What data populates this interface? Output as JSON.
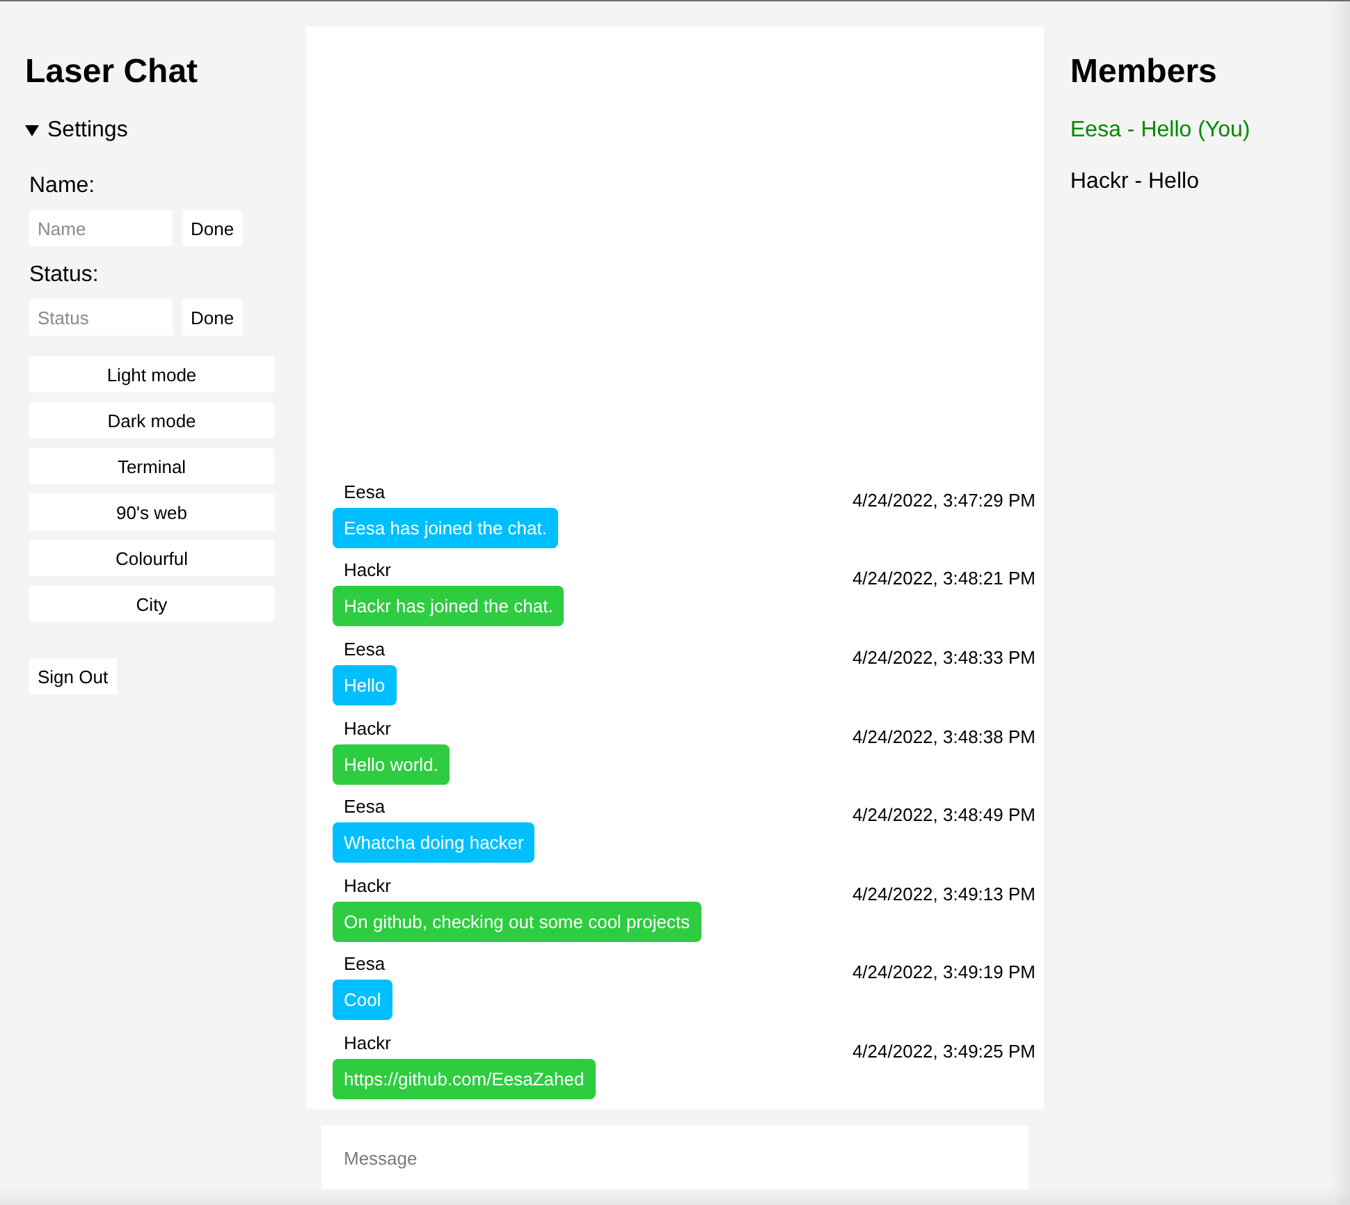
{
  "sidebar": {
    "title": "Laser Chat",
    "settings": {
      "label": "Settings",
      "expanded": true,
      "fields": [
        {
          "label": "Name:",
          "placeholder": "Name",
          "button": "Done"
        },
        {
          "label": "Status:",
          "placeholder": "Status",
          "button": "Done"
        }
      ],
      "themes": [
        "Light mode",
        "Dark mode",
        "Terminal",
        "90's web",
        "Colourful",
        "City"
      ]
    },
    "sign_out": "Sign Out"
  },
  "chat": {
    "messages": [
      {
        "author": "Eesa",
        "text": "Eesa has joined the chat.",
        "time": "4/24/2022, 3:47:29 PM",
        "color": "#00bfff"
      },
      {
        "author": "Hackr",
        "text": "Hackr has joined the chat.",
        "time": "4/24/2022, 3:48:21 PM",
        "color": "#2ecc40"
      },
      {
        "author": "Eesa",
        "text": "Hello",
        "time": "4/24/2022, 3:48:33 PM",
        "color": "#00bfff"
      },
      {
        "author": "Hackr",
        "text": "Hello world.",
        "time": "4/24/2022, 3:48:38 PM",
        "color": "#2ecc40"
      },
      {
        "author": "Eesa",
        "text": "Whatcha doing hacker",
        "time": "4/24/2022, 3:48:49 PM",
        "color": "#00bfff"
      },
      {
        "author": "Hackr",
        "text": "On github, checking out some cool projects",
        "time": "4/24/2022, 3:49:13 PM",
        "color": "#2ecc40"
      },
      {
        "author": "Eesa",
        "text": "Cool",
        "time": "4/24/2022, 3:49:19 PM",
        "color": "#00bfff"
      },
      {
        "author": "Hackr",
        "text": "https://github.com/EesaZahed",
        "time": "4/24/2022, 3:49:25 PM",
        "color": "#2ecc40"
      }
    ]
  },
  "composer": {
    "placeholder": "Message"
  },
  "members": {
    "title": "Members",
    "items": [
      {
        "label": "Eesa - Hello (You)",
        "you": true
      },
      {
        "label": "Hackr - Hello",
        "you": false
      }
    ]
  }
}
